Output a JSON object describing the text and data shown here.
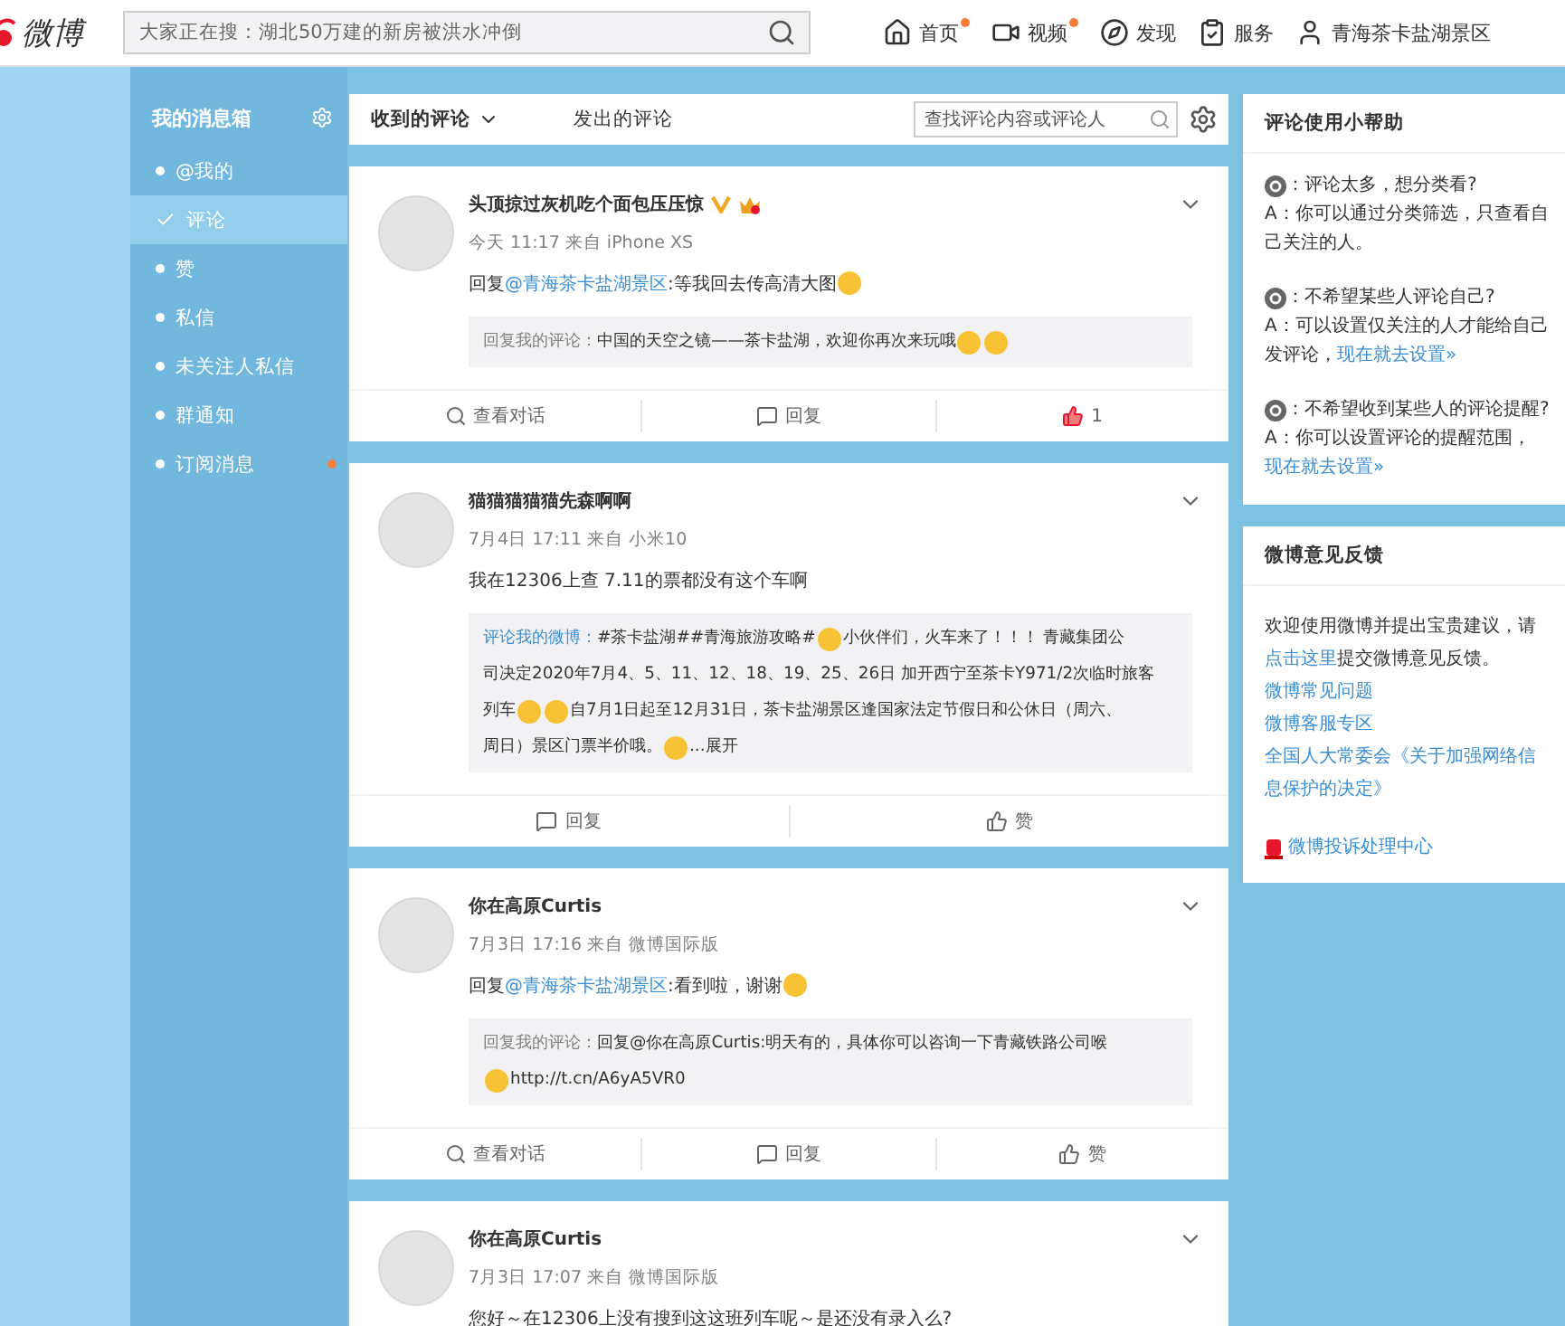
{
  "top_bar": {
    "logo": "微博",
    "search": {
      "placeholder": "大家正在搜：湖北50万建的新房被洪水冲倒"
    },
    "nav": [
      {
        "kind": "home",
        "label": "首页",
        "badge": true
      },
      {
        "kind": "video",
        "label": "视频",
        "badge": true
      },
      {
        "kind": "discover",
        "label": "发现",
        "badge": false
      },
      {
        "kind": "service",
        "label": "服务",
        "badge": false
      },
      {
        "kind": "user",
        "label": "青海茶卡盐湖景区",
        "badge": false
      }
    ]
  },
  "sidebar": {
    "title": "我的消息箱",
    "items": [
      {
        "label": "@我的",
        "selected": false,
        "badge": false
      },
      {
        "label": "评论",
        "selected": true,
        "badge": false
      },
      {
        "label": "赞",
        "selected": false,
        "badge": false
      },
      {
        "label": "私信",
        "selected": false,
        "badge": false
      },
      {
        "label": "未关注人私信",
        "selected": false,
        "badge": false
      },
      {
        "label": "群通知",
        "selected": false,
        "badge": false
      },
      {
        "label": "订阅消息",
        "selected": false,
        "badge": true
      }
    ]
  },
  "tabs": [
    {
      "label": "收到的评论",
      "selected": true
    },
    {
      "label": "发出的评论",
      "selected": false
    }
  ],
  "comment_search": {
    "placeholder": "查找评论内容或评论人"
  },
  "comments": [
    {
      "name": "头顶掠过灰机吃个面包压压惊",
      "verified": true,
      "vip": true,
      "meta": "今天 11:17 来自 iPhone XS",
      "body": [
        {
          "kind": "text",
          "text": "回复"
        },
        {
          "kind": "mention",
          "text": "@青海茶卡盐湖景区"
        },
        {
          "kind": "text",
          "text": ":等我回去传高清大图"
        },
        {
          "kind": "emoji"
        }
      ],
      "quote": [
        [
          {
            "kind": "label",
            "text": "回复我的评论："
          },
          {
            "kind": "text",
            "text": "中国的天空之镜——茶卡盐湖，欢迎你再次来玩哦"
          },
          {
            "kind": "emoji"
          },
          {
            "kind": "emoji"
          }
        ]
      ],
      "actions": [
        {
          "kind": "view",
          "label": "查看对话",
          "liked": false
        },
        {
          "kind": "reply",
          "label": "回复",
          "liked": false
        },
        {
          "kind": "like",
          "label": "1",
          "liked": true
        }
      ]
    },
    {
      "name": "猫猫猫猫猫先森啊啊",
      "verified": false,
      "vip": false,
      "meta": "7月4日 17:11 来自 小米10",
      "body": [
        {
          "kind": "text",
          "text": "我在12306上查 7.11的票都没有这个车啊"
        }
      ],
      "quote": [
        [
          {
            "kind": "mention",
            "text": "评论我的微博："
          },
          {
            "kind": "text",
            "text": "#茶卡盐湖##青海旅游攻略#"
          },
          {
            "kind": "emoji"
          },
          {
            "kind": "text",
            "text": "小伙伴们，火车来了！！！ 青藏集团公"
          }
        ],
        [
          {
            "kind": "text",
            "text": "司决定2020年7月4、5、11、12、18、19、25、26日 加开西宁至茶卡Y971/2次临时旅客"
          }
        ],
        [
          {
            "kind": "text",
            "text": "列车"
          },
          {
            "kind": "emoji"
          },
          {
            "kind": "emoji"
          },
          {
            "kind": "text",
            "text": "自7月1日起至12月31日，茶卡盐湖景区逢国家法定节假日和公休日（周六、"
          }
        ],
        [
          {
            "kind": "text",
            "text": "周日）景区门票半价哦。"
          },
          {
            "kind": "emoji"
          },
          {
            "kind": "text",
            "text": "...展开"
          }
        ]
      ],
      "actions": [
        {
          "kind": "reply",
          "label": "回复",
          "liked": false
        },
        {
          "kind": "like",
          "label": "赞",
          "liked": false
        }
      ]
    },
    {
      "name": "你在高原Curtis",
      "verified": false,
      "vip": false,
      "meta": "7月3日 17:16 来自 微博国际版",
      "body": [
        {
          "kind": "text",
          "text": "回复"
        },
        {
          "kind": "mention",
          "text": "@青海茶卡盐湖景区"
        },
        {
          "kind": "text",
          "text": ":看到啦，谢谢"
        },
        {
          "kind": "emoji"
        }
      ],
      "quote": [
        [
          {
            "kind": "label",
            "text": "回复我的评论："
          },
          {
            "kind": "text",
            "text": "回复@你在高原Curtis:明天有的，具体你可以咨询一下青藏铁路公司喉"
          }
        ],
        [
          {
            "kind": "emoji"
          },
          {
            "kind": "text",
            "text": "http://t.cn/A6yA5VR0"
          }
        ]
      ],
      "actions": [
        {
          "kind": "view",
          "label": "查看对话",
          "liked": false
        },
        {
          "kind": "reply",
          "label": "回复",
          "liked": false
        },
        {
          "kind": "like",
          "label": "赞",
          "liked": false
        }
      ]
    },
    {
      "name": "你在高原Curtis",
      "verified": false,
      "vip": false,
      "meta": "7月3日 17:07 来自 微博国际版",
      "body": [
        {
          "kind": "text",
          "text": "您好～在12306上没有搜到这这班列车呢～是还没有录入么?"
        }
      ]
    }
  ],
  "help": {
    "title": "评论使用小帮助",
    "items": [
      {
        "question": "：评论太多，想分类看?",
        "answer": "A：你可以通过分类筛选，只查看自己关注的人。"
      },
      {
        "question": "：不希望某些人评论自己?",
        "answer": "A：可以设置仅关注的人才能给自己发评论，",
        "link": "现在就去设置»"
      },
      {
        "question": "：不希望收到某些人的评论提醒?",
        "answer": "A：你可以设置评论的提醒范围，",
        "link": "现在就去设置»"
      }
    ]
  },
  "feedback": {
    "title": "微博意见反馈",
    "intro": "欢迎使用微博并提出宝贵建议，请",
    "intro_link": "点击这里",
    "intro_end": "提交微博意见反馈。",
    "links": [
      "微博常见问题",
      "微博客服专区",
      "全国人大常委会《关于加强网络信息保护的决定》"
    ],
    "complaint": "微博投诉处理中心"
  }
}
